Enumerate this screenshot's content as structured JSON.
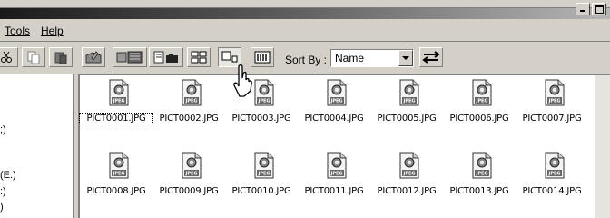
{
  "menu": {
    "tools_label": "Tools",
    "help_label": "Help"
  },
  "toolbar": {
    "sort_by_label": "Sort By :",
    "sort_by_value": "Name"
  },
  "tree": {
    "items": [
      ";)",
      "(E:)",
      ":)",
      ")"
    ]
  },
  "files": [
    {
      "name": "PICT0001.JPG",
      "selected": true
    },
    {
      "name": "PICT0002.JPG"
    },
    {
      "name": "PICT0003.JPG"
    },
    {
      "name": "PICT0004.JPG"
    },
    {
      "name": "PICT0005.JPG"
    },
    {
      "name": "PICT0006.JPG"
    },
    {
      "name": "PICT0007.JPG"
    },
    {
      "name": "PICT0008.JPG"
    },
    {
      "name": "PICT0009.JPG"
    },
    {
      "name": "PICT0010.JPG"
    },
    {
      "name": "PICT0011.JPG"
    },
    {
      "name": "PICT0012.JPG"
    },
    {
      "name": "PICT0013.JPG"
    },
    {
      "name": "PICT0014.JPG"
    }
  ],
  "icons": {
    "file_type_badge": "JPEG",
    "file": "jpeg-file-icon",
    "cursor": "hand-pointer-icon"
  },
  "colors": {
    "window_bg": "#d4d0c8",
    "title_dark": "#1a1a1a",
    "pane_bg": "#ffffff"
  }
}
